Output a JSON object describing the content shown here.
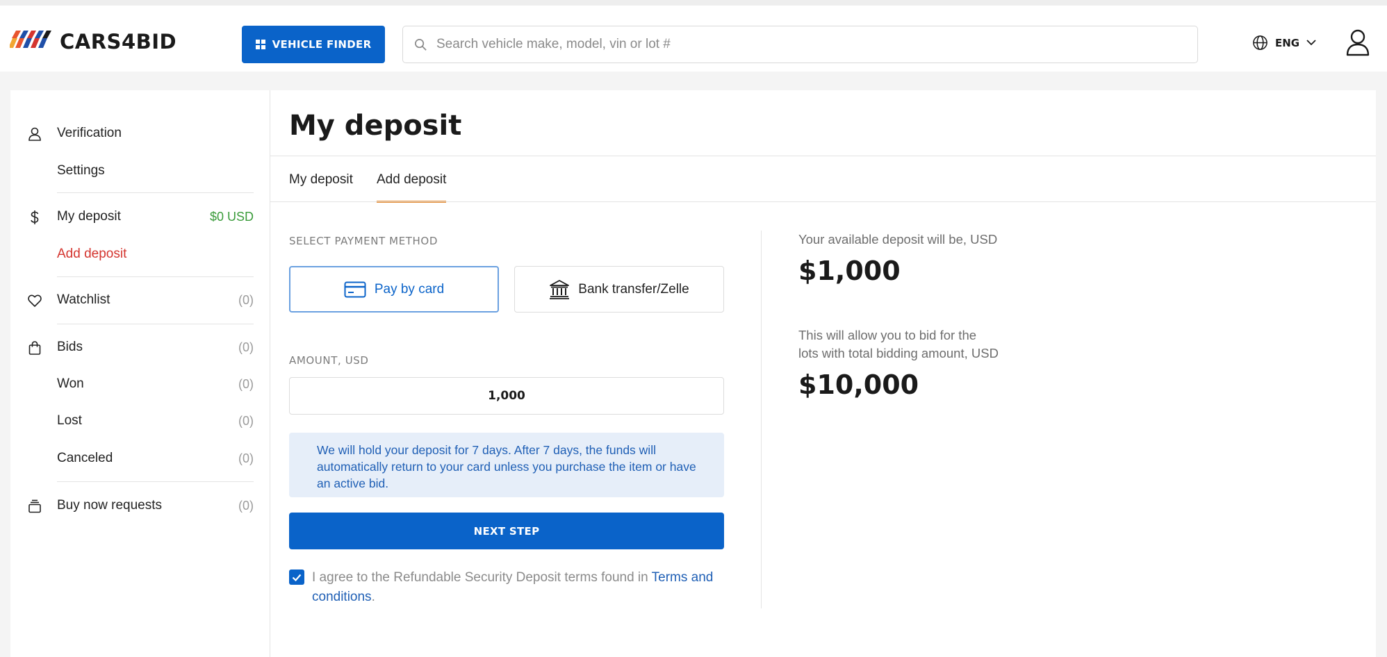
{
  "header": {
    "logo_text": "CARS4BID",
    "vehicle_finder_label": "VEHICLE FINDER",
    "search_placeholder": "Search vehicle make, model, vin or lot #",
    "language": "ENG"
  },
  "sidebar": {
    "verification": "Verification",
    "settings": "Settings",
    "my_deposit": "My deposit",
    "my_deposit_amount": "$0 USD",
    "add_deposit": "Add deposit",
    "watchlist": "Watchlist",
    "watchlist_count": "(0)",
    "bids": "Bids",
    "bids_count": "(0)",
    "won": "Won",
    "won_count": "(0)",
    "lost": "Lost",
    "lost_count": "(0)",
    "canceled": "Canceled",
    "canceled_count": "(0)",
    "buy_now": "Buy now requests",
    "buy_now_count": "(0)"
  },
  "main": {
    "title": "My deposit",
    "tabs": [
      {
        "label": "My deposit"
      },
      {
        "label": "Add deposit"
      }
    ],
    "select_payment_label": "SELECT PAYMENT METHOD",
    "pay_by_card": "Pay by card",
    "bank_transfer": "Bank transfer/Zelle",
    "amount_label": "AMOUNT, USD",
    "amount_value": "1,000",
    "notice": "We will hold your deposit for 7 days. After 7 days, the funds will automatically return to your card unless you purchase the item or have an active bid.",
    "next_step": "NEXT STEP",
    "agree_text": "I agree to the Refundable Security Deposit terms found in ",
    "terms_link": "Terms and conditions",
    "agree_end": ".",
    "available_label": "Your available deposit will be, USD",
    "available_value": "$1,000",
    "allow_label_1": "This will allow you to bid for the",
    "allow_label_2": "lots with total bidding amount, USD",
    "allow_value": "$10,000"
  },
  "colors": {
    "brand_blue": "#0a63c9",
    "accent_orange": "#e88a2c",
    "active_red": "#d4352f",
    "amount_green": "#3a9b3a"
  }
}
